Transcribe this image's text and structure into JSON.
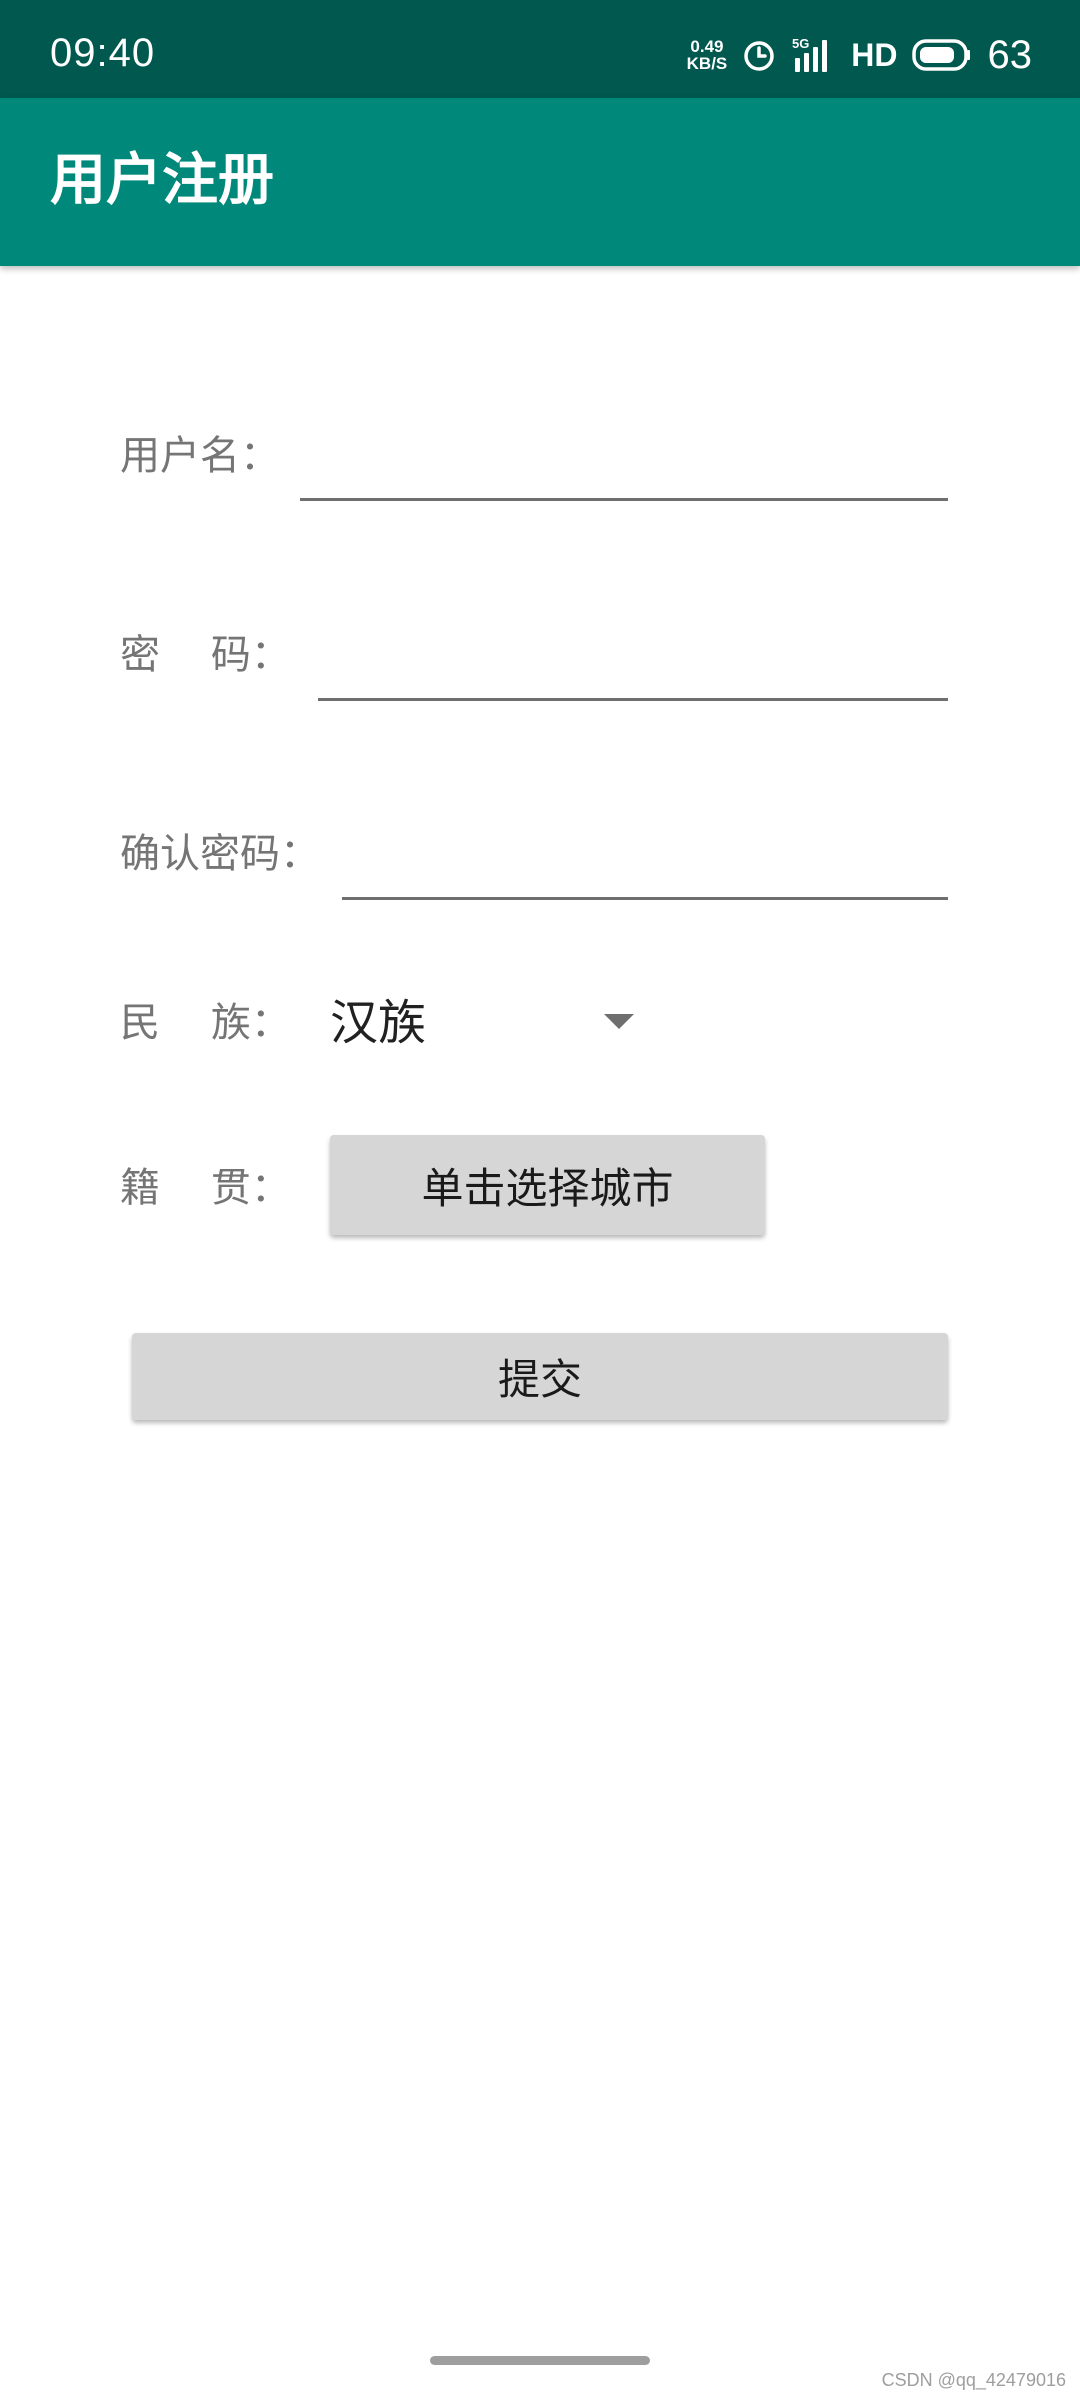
{
  "status_bar": {
    "time": "09:40",
    "net_speed_value": "0.49",
    "net_speed_unit": "KB/S",
    "signal_label": "5G",
    "hd_label": "HD",
    "battery_level": "63",
    "icons": [
      "alarm-icon",
      "signal-5g-icon",
      "battery-icon"
    ]
  },
  "app_bar": {
    "title": "用户注册"
  },
  "form": {
    "username_label": "用户名：",
    "username_value": "",
    "password_label": "密    码：",
    "password_value": "",
    "confirm_label": "确认密码：",
    "confirm_value": "",
    "ethnicity_label": "民    族：",
    "ethnicity_selected": "汉族",
    "native_place_label": "籍    贯：",
    "native_place_button": "单击选择城市",
    "submit_button": "提交"
  },
  "watermark": "CSDN @qq_42479016",
  "colors": {
    "status_bar_bg": "#00584e",
    "app_bar_bg": "#00897b",
    "button_bg": "#d6d6d6",
    "label_text": "#757575"
  }
}
